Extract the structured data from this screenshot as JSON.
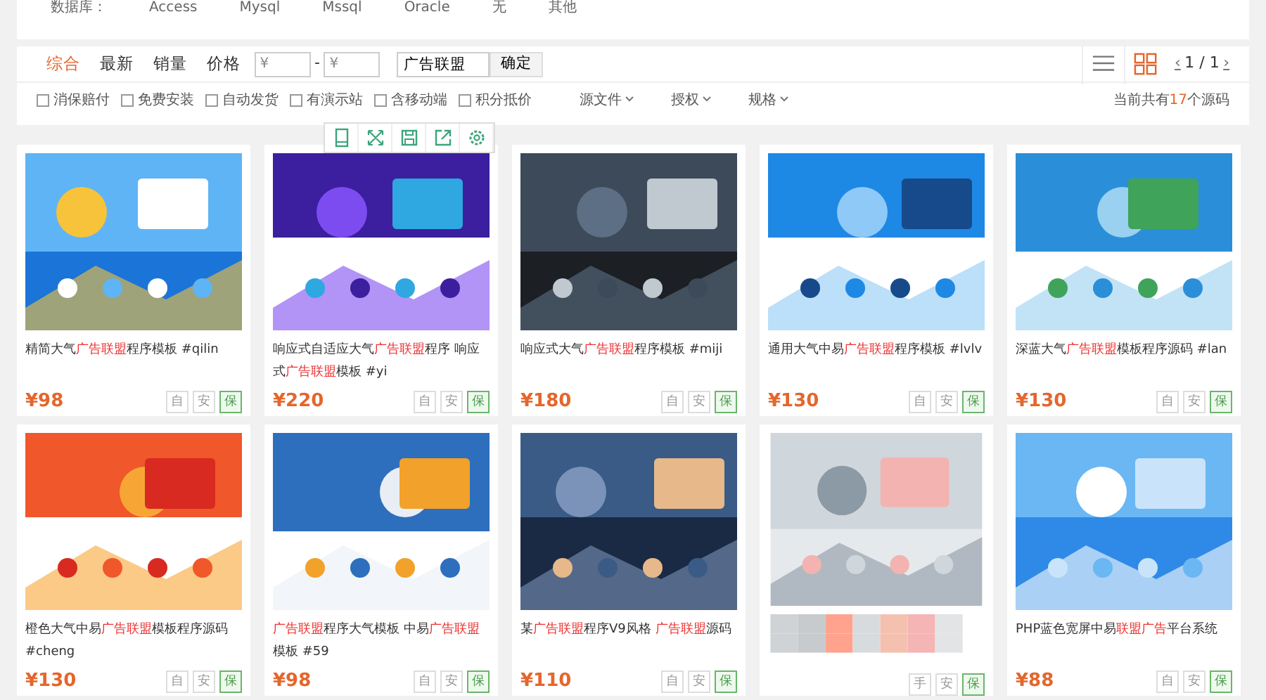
{
  "database_filter": {
    "label": "数据库：",
    "options": [
      "Access",
      "Mysql",
      "Mssql",
      "Oracle",
      "无",
      "其他"
    ]
  },
  "sort_tabs": [
    {
      "label": "综合",
      "selected": true
    },
    {
      "label": "最新",
      "selected": false
    },
    {
      "label": "销量",
      "selected": false
    },
    {
      "label": "价格",
      "selected": false
    }
  ],
  "price_range": {
    "min_placeholder": "¥",
    "separator": "-",
    "max_placeholder": "¥"
  },
  "keyword": {
    "value": "广告联盟"
  },
  "confirm_button": "确定",
  "view_modes": [
    {
      "kind": "list",
      "selected": false
    },
    {
      "kind": "grid",
      "selected": true
    }
  ],
  "pager": {
    "prev": "‹",
    "text": "1 / 1",
    "next": "›"
  },
  "checkboxes": [
    {
      "label": "消保赔付",
      "checked": false
    },
    {
      "label": "免费安装",
      "checked": false
    },
    {
      "label": "自动发货",
      "checked": false
    },
    {
      "label": "有演示站",
      "checked": false
    },
    {
      "label": "含移动端",
      "checked": false
    },
    {
      "label": "积分抵价",
      "checked": false
    }
  ],
  "dropdowns": [
    "源文件",
    "授权",
    "规格"
  ],
  "result_count": {
    "before": "当前共有",
    "count": "17",
    "after": "个源码"
  },
  "hover_tools": [
    {
      "kind": "tablet"
    },
    {
      "kind": "fullscreen"
    },
    {
      "kind": "save"
    },
    {
      "kind": "share"
    },
    {
      "kind": "settings"
    }
  ],
  "cards": [
    {
      "title": [
        {
          "text": "精简大气",
          "highlight": false
        },
        {
          "text": "广告联盟",
          "highlight": true
        },
        {
          "text": "程序模板 #qilin",
          "highlight": false
        }
      ],
      "price": "¥98",
      "tags": [
        {
          "text": "自",
          "kind": "plain"
        },
        {
          "text": "安",
          "kind": "plain"
        },
        {
          "text": "保",
          "kind": "guarantee"
        }
      ]
    },
    {
      "title": [
        {
          "text": "响应式自适应大气",
          "highlight": false
        },
        {
          "text": "广告联盟",
          "highlight": true
        },
        {
          "text": "程序 响应式",
          "highlight": false
        },
        {
          "text": "广告联盟",
          "highlight": true
        },
        {
          "text": "模板 #yi",
          "highlight": false
        }
      ],
      "price": "¥220",
      "tags": [
        {
          "text": "自",
          "kind": "plain"
        },
        {
          "text": "安",
          "kind": "plain"
        },
        {
          "text": "保",
          "kind": "guarantee"
        }
      ]
    },
    {
      "title": [
        {
          "text": "响应式大气",
          "highlight": false
        },
        {
          "text": "广告联盟",
          "highlight": true
        },
        {
          "text": "程序模板 #miji",
          "highlight": false
        }
      ],
      "price": "¥180",
      "tags": [
        {
          "text": "自",
          "kind": "plain"
        },
        {
          "text": "安",
          "kind": "plain"
        },
        {
          "text": "保",
          "kind": "guarantee"
        }
      ]
    },
    {
      "title": [
        {
          "text": "通用大气中易",
          "highlight": false
        },
        {
          "text": "广告联盟",
          "highlight": true
        },
        {
          "text": "程序模板 #lvlv",
          "highlight": false
        }
      ],
      "price": "¥130",
      "tags": [
        {
          "text": "自",
          "kind": "plain"
        },
        {
          "text": "安",
          "kind": "plain"
        },
        {
          "text": "保",
          "kind": "guarantee"
        }
      ]
    },
    {
      "title": [
        {
          "text": "深蓝大气",
          "highlight": false
        },
        {
          "text": "广告联盟",
          "highlight": true
        },
        {
          "text": "模板程序源码 #lan",
          "highlight": false
        }
      ],
      "price": "¥130",
      "tags": [
        {
          "text": "自",
          "kind": "plain"
        },
        {
          "text": "安",
          "kind": "plain"
        },
        {
          "text": "保",
          "kind": "guarantee"
        }
      ]
    },
    {
      "title": [
        {
          "text": "橙色大气中易",
          "highlight": false
        },
        {
          "text": "广告联盟",
          "highlight": true
        },
        {
          "text": "模板程序源码 #cheng",
          "highlight": false
        }
      ],
      "price": "¥130",
      "tags": [
        {
          "text": "自",
          "kind": "plain"
        },
        {
          "text": "安",
          "kind": "plain"
        },
        {
          "text": "保",
          "kind": "guarantee"
        }
      ]
    },
    {
      "title": [
        {
          "text": "广告联盟",
          "highlight": true
        },
        {
          "text": "程序大气模板 中易",
          "highlight": false
        },
        {
          "text": "广告联盟",
          "highlight": true
        },
        {
          "text": "模板 #59",
          "highlight": false
        }
      ],
      "price": "¥98",
      "tags": [
        {
          "text": "自",
          "kind": "plain"
        },
        {
          "text": "安",
          "kind": "plain"
        },
        {
          "text": "保",
          "kind": "guarantee"
        }
      ]
    },
    {
      "title": [
        {
          "text": "某",
          "highlight": false
        },
        {
          "text": "广告联盟",
          "highlight": true
        },
        {
          "text": "程序V9风格 ",
          "highlight": false
        },
        {
          "text": "广告联盟",
          "highlight": true
        },
        {
          "text": "源码",
          "highlight": false
        }
      ],
      "price": "¥110",
      "tags": [
        {
          "text": "自",
          "kind": "plain"
        },
        {
          "text": "安",
          "kind": "plain"
        },
        {
          "text": "保",
          "kind": "guarantee"
        }
      ]
    },
    {
      "obscured": true,
      "tags": [
        {
          "text": "手",
          "kind": "plain"
        },
        {
          "text": "安",
          "kind": "plain"
        },
        {
          "text": "保",
          "kind": "guarantee"
        }
      ]
    },
    {
      "title": [
        {
          "text": "PHP蓝色宽屏中易",
          "highlight": false
        },
        {
          "text": "联盟广告",
          "highlight": true
        },
        {
          "text": "平台系统",
          "highlight": false
        }
      ],
      "price": "¥88",
      "tags": [
        {
          "text": "自",
          "kind": "plain"
        },
        {
          "text": "安",
          "kind": "plain"
        },
        {
          "text": "保",
          "kind": "guarantee"
        }
      ]
    }
  ]
}
